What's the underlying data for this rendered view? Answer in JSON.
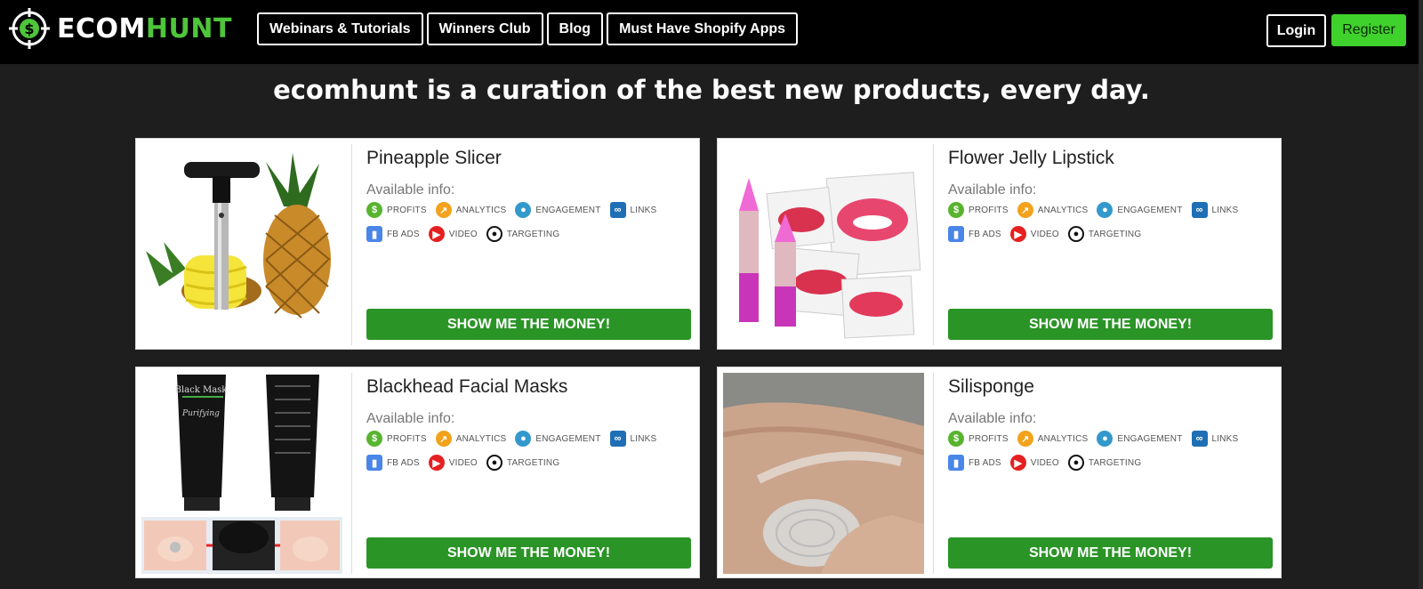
{
  "brand": {
    "part1": "ECOM",
    "part2": "HUNT",
    "accent": "#4ec53a"
  },
  "nav": [
    {
      "label": "Webinars & Tutorials"
    },
    {
      "label": "Winners Club"
    },
    {
      "label": "Blog"
    },
    {
      "label": "Must Have Shopify Apps"
    }
  ],
  "auth": {
    "login": "Login",
    "register": "Register"
  },
  "tagline": "ecomhunt is a curation of the best new products, every day.",
  "labels": {
    "available_info": "Available info:",
    "cta": "SHOW ME THE MONEY!",
    "features": {
      "profits": "PROFITS",
      "analytics": "ANALYTICS",
      "engagement": "ENGAGEMENT",
      "links": "LINKS",
      "fb_ads": "FB ADS",
      "video": "VIDEO",
      "targeting": "TARGETING"
    }
  },
  "products": [
    {
      "title": "Pineapple Slicer"
    },
    {
      "title": "Flower Jelly Lipstick"
    },
    {
      "title": "Blackhead Facial Masks",
      "image_text": "Black Mask"
    },
    {
      "title": "Silisponge"
    }
  ],
  "colors": {
    "cta": "#2b9427",
    "register": "#3fd12c"
  }
}
